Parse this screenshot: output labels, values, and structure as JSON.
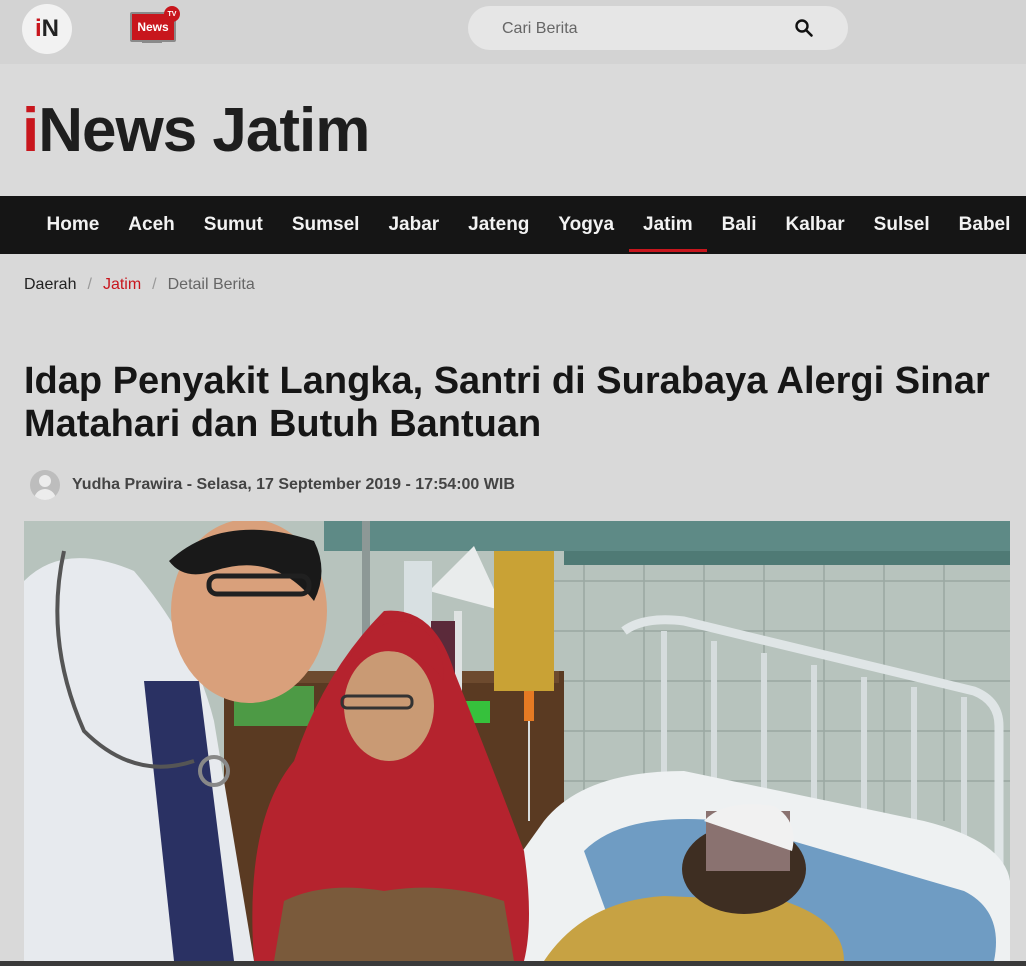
{
  "topbar": {
    "logo_text_i": "i",
    "logo_text_n": "N",
    "newstv_label": "News",
    "newstv_badge": "TV",
    "search_placeholder": "Cari Berita"
  },
  "brand": {
    "title_i": "i",
    "title_rest": "News Jatim"
  },
  "nav": {
    "items": [
      "Home",
      "Aceh",
      "Sumut",
      "Sumsel",
      "Jabar",
      "Jateng",
      "Yogya",
      "Jatim",
      "Bali",
      "Kalbar",
      "Sulsel",
      "Babel"
    ],
    "active": "Jatim"
  },
  "breadcrumb": {
    "items": [
      "Daerah",
      "Jatim",
      "Detail Berita"
    ],
    "separator": "/"
  },
  "article": {
    "headline": "Idap Penyakit Langka, Santri di Surabaya Alergi Sinar Matahari dan Butuh Bantuan",
    "byline": "Yudha Prawira - Selasa, 17 September 2019 - 17:54:00 WIB"
  },
  "colors": {
    "accent": "#c8161d",
    "nav_bg": "#151515",
    "page_bg": "#d9d9d9"
  },
  "icons": {
    "search": "search-icon",
    "avatar": "user-avatar-icon",
    "tv": "tv-icon"
  }
}
